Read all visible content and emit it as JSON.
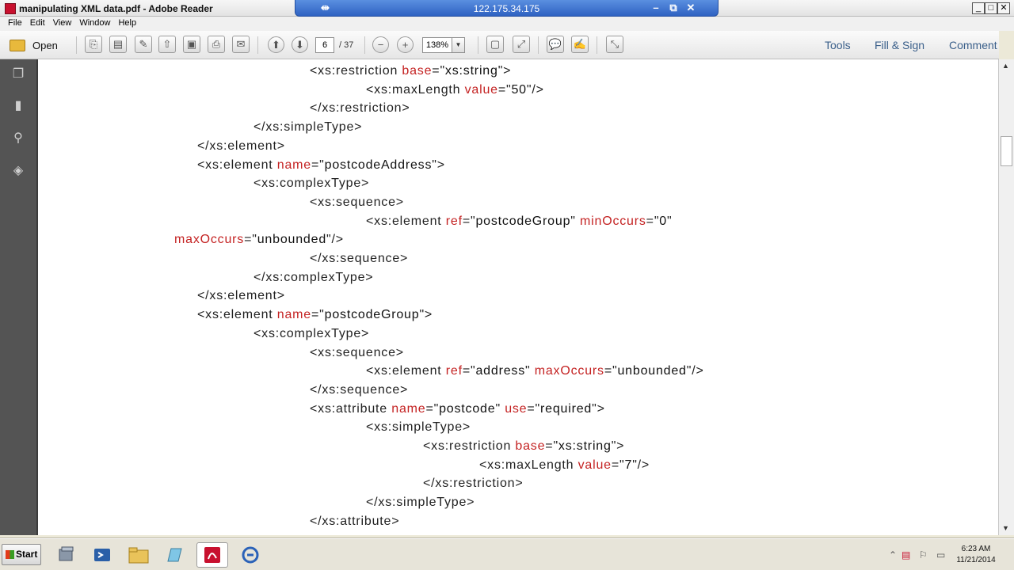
{
  "window": {
    "title": "manipulating XML data.pdf - Adobe Reader",
    "remote_host": "122.175.34.175",
    "pin_glyph": "⇹",
    "rdp_min_glyph": "–",
    "rdp_restore_glyph": "⧉",
    "rdp_close_glyph": "✕",
    "min_glyph": "_",
    "max_glyph": "□",
    "close_glyph": "✕"
  },
  "menu": [
    "File",
    "Edit",
    "View",
    "Window",
    "Help"
  ],
  "toolbar": {
    "open_label": "Open",
    "page_value": "6",
    "page_total": "/ 37",
    "zoom_value": "138%",
    "links": [
      "Tools",
      "Fill & Sign",
      "Comment"
    ]
  },
  "icons": {
    "create": "⎘",
    "pdf": "▤",
    "edit": "✎",
    "upload": "⇧",
    "save": "▣",
    "print": "⎙",
    "email": "✉",
    "prev": "⬆",
    "next": "⬇",
    "zoom_out": "−",
    "zoom_in": "+",
    "dropdown": "▼",
    "fit_page": "▢",
    "fit_width": "⤢",
    "comment": "💬",
    "sign": "✍",
    "fullscreen": "⤡",
    "pages": "❐",
    "bookmarks": "▮",
    "attachments": "⚲",
    "layers": "◈",
    "scroll_up": "▲",
    "scroll_down": "▼",
    "tray_up": "⌃",
    "tray_flag": "⚐",
    "tray_network": "▭",
    "tray_volume": "◔"
  },
  "document": {
    "lines": [
      [
        {
          "t": "t",
          "s": "<xs:restriction "
        },
        {
          "t": "a",
          "s": "base"
        },
        {
          "t": "t",
          "s": "=\""
        },
        {
          "t": "v",
          "s": "xs:string"
        },
        {
          "t": "t",
          "s": "\">"
        }
      ],
      [
        {
          "t": "t",
          "s": "<xs:maxLength "
        },
        {
          "t": "a",
          "s": "value"
        },
        {
          "t": "t",
          "s": "=\""
        },
        {
          "t": "v",
          "s": "50"
        },
        {
          "t": "t",
          "s": "\"/>"
        }
      ],
      [
        {
          "t": "t",
          "s": "</xs:restriction>"
        }
      ],
      [
        {
          "t": "t",
          "s": "</xs:simpleType>"
        }
      ],
      [
        {
          "t": "t",
          "s": "</xs:element>"
        }
      ],
      [
        {
          "t": "t",
          "s": "<xs:element "
        },
        {
          "t": "a",
          "s": "name"
        },
        {
          "t": "t",
          "s": "=\""
        },
        {
          "t": "v",
          "s": "postcodeAddress"
        },
        {
          "t": "t",
          "s": "\">"
        }
      ],
      [
        {
          "t": "t",
          "s": "<xs:complexType>"
        }
      ],
      [
        {
          "t": "t",
          "s": "<xs:sequence>"
        }
      ],
      [
        {
          "t": "t",
          "s": "<xs:element "
        },
        {
          "t": "a",
          "s": "ref"
        },
        {
          "t": "t",
          "s": "=\""
        },
        {
          "t": "v",
          "s": "postcodeGroup"
        },
        {
          "t": "t",
          "s": "\" "
        },
        {
          "t": "a",
          "s": "minOccurs"
        },
        {
          "t": "t",
          "s": "=\""
        },
        {
          "t": "v",
          "s": "0"
        },
        {
          "t": "t",
          "s": "\""
        }
      ],
      [
        {
          "t": "a",
          "s": "maxOccurs"
        },
        {
          "t": "t",
          "s": "=\""
        },
        {
          "t": "v",
          "s": "unbounded"
        },
        {
          "t": "t",
          "s": "\"/>"
        }
      ],
      [
        {
          "t": "t",
          "s": "</xs:sequence>"
        }
      ],
      [
        {
          "t": "t",
          "s": "</xs:complexType>"
        }
      ],
      [
        {
          "t": "t",
          "s": "</xs:element>"
        }
      ],
      [
        {
          "t": "t",
          "s": "<xs:element "
        },
        {
          "t": "a",
          "s": "name"
        },
        {
          "t": "t",
          "s": "=\""
        },
        {
          "t": "v",
          "s": "postcodeGroup"
        },
        {
          "t": "t",
          "s": "\">"
        }
      ],
      [
        {
          "t": "t",
          "s": "<xs:complexType>"
        }
      ],
      [
        {
          "t": "t",
          "s": "<xs:sequence>"
        }
      ],
      [
        {
          "t": "t",
          "s": "<xs:element "
        },
        {
          "t": "a",
          "s": "ref"
        },
        {
          "t": "t",
          "s": "=\""
        },
        {
          "t": "v",
          "s": "address"
        },
        {
          "t": "t",
          "s": "\" "
        },
        {
          "t": "a",
          "s": "maxOccurs"
        },
        {
          "t": "t",
          "s": "=\""
        },
        {
          "t": "v",
          "s": "unbounded"
        },
        {
          "t": "t",
          "s": "\"/>"
        }
      ],
      [
        {
          "t": "t",
          "s": "</xs:sequence>"
        }
      ],
      [
        {
          "t": "t",
          "s": "<xs:attribute "
        },
        {
          "t": "a",
          "s": "name"
        },
        {
          "t": "t",
          "s": "=\""
        },
        {
          "t": "v",
          "s": "postcode"
        },
        {
          "t": "t",
          "s": "\" "
        },
        {
          "t": "a",
          "s": "use"
        },
        {
          "t": "t",
          "s": "=\""
        },
        {
          "t": "v",
          "s": "required"
        },
        {
          "t": "t",
          "s": "\">"
        }
      ],
      [
        {
          "t": "t",
          "s": "<xs:simpleType>"
        }
      ],
      [
        {
          "t": "t",
          "s": "<xs:restriction "
        },
        {
          "t": "a",
          "s": "base"
        },
        {
          "t": "t",
          "s": "=\""
        },
        {
          "t": "v",
          "s": "xs:string"
        },
        {
          "t": "t",
          "s": "\">"
        }
      ],
      [
        {
          "t": "t",
          "s": "<xs:maxLength "
        },
        {
          "t": "a",
          "s": "value"
        },
        {
          "t": "t",
          "s": "=\""
        },
        {
          "t": "v",
          "s": "7"
        },
        {
          "t": "t",
          "s": "\"/>"
        }
      ],
      [
        {
          "t": "t",
          "s": "</xs:restriction>"
        }
      ],
      [
        {
          "t": "t",
          "s": "</xs:simpleType>"
        }
      ],
      [
        {
          "t": "t",
          "s": "</xs:attribute>"
        }
      ]
    ]
  },
  "taskbar": {
    "start_label": "Start",
    "clock_time": "6:23 AM",
    "clock_date": "11/21/2014"
  },
  "colors": {
    "attribute": "#c42222",
    "sidebar": "#545454",
    "rdp_bar": "#2f62c2"
  }
}
